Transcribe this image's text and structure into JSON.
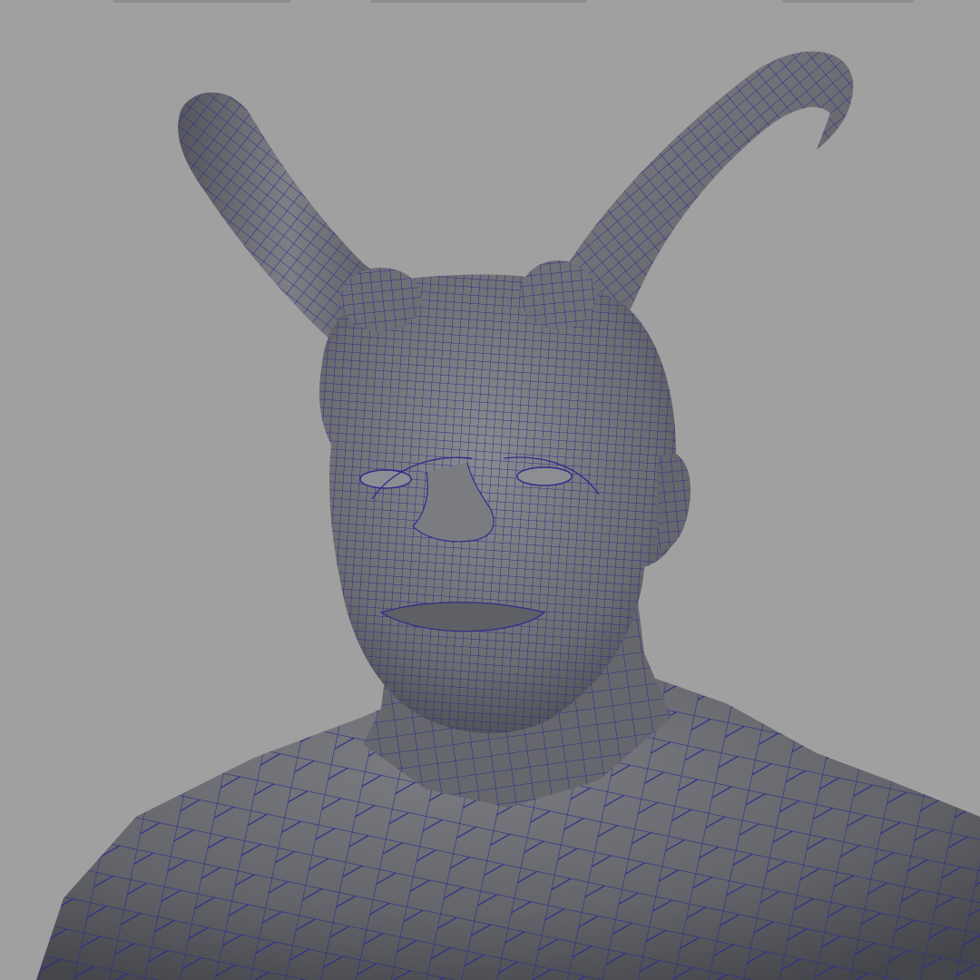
{
  "viewport": {
    "background_color": "#a0a0a0"
  },
  "model": {
    "surface_color": "#6c6d72",
    "wire_color": "#2e2c8c",
    "shading_highlight": "#8a8b90",
    "shading_shadow": "#4a4b50"
  }
}
